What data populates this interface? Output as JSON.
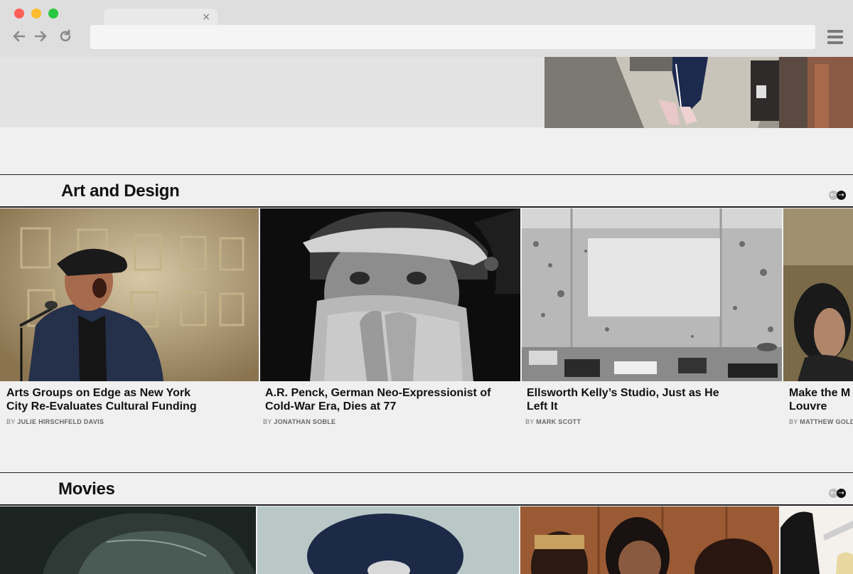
{
  "browser": {
    "tab_close": "×",
    "url": ""
  },
  "sections": [
    {
      "title": "Art and Design",
      "cards": [
        {
          "headline": "Arts Groups on Edge as New York City Re-Evaluates Cultural Funding",
          "byline_prefix": "BY",
          "author": "JULIE HIRSCHFELD DAVIS"
        },
        {
          "headline": "A.R. Penck, German Neo-Expressionist of Cold-War Era, Dies at 77",
          "byline_prefix": "BY",
          "author": "JONATHAN SOBLE"
        },
        {
          "headline": "Ellsworth Kelly’s Studio, Just as He Left It",
          "byline_prefix": "BY",
          "author": "MARK SCOTT"
        },
        {
          "headline": "Make the M Louvre",
          "byline_prefix": "BY",
          "author": "MATTHEW GOLD"
        }
      ]
    },
    {
      "title": "Movies"
    }
  ],
  "colors": {
    "page_bg": "#f0f0f0",
    "rule": "#222222",
    "headline": "#111111",
    "byline": "#777777"
  },
  "icons": [
    "back-arrow-icon",
    "forward-arrow-icon",
    "reload-icon",
    "hamburger-menu-icon",
    "carousel-prev-icon",
    "carousel-next-icon",
    "tab-close-icon"
  ]
}
